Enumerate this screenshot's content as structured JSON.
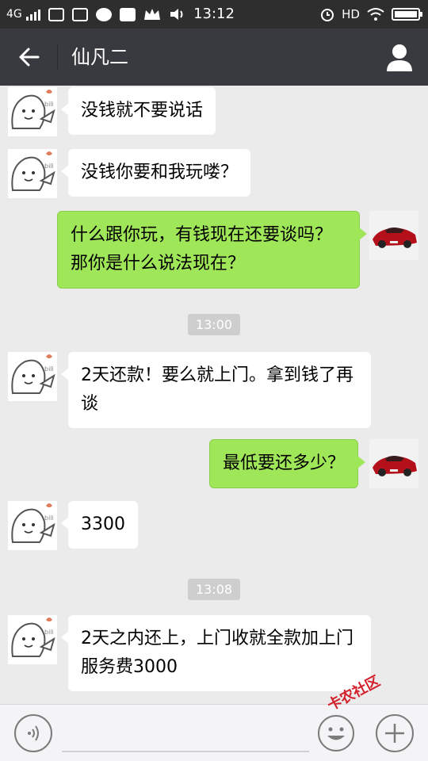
{
  "status_bar": {
    "network": "4G",
    "indicator": "HD",
    "time": "13:12",
    "icons": [
      "signal-icon",
      "gallery-icon",
      "wallet-icon",
      "chat-icon",
      "mail-icon",
      "crown-icon",
      "volume-icon",
      "alarm-icon",
      "wifi-icon",
      "battery-icon"
    ]
  },
  "header": {
    "title": "仙凡二",
    "back_icon": "arrow-left-icon",
    "profile_icon": "person-icon"
  },
  "messages": [
    {
      "type": "in",
      "text": "没钱就不要说话"
    },
    {
      "type": "in",
      "text": "没钱你要和我玩喽？"
    },
    {
      "type": "out",
      "text": "什么跟你玩，有钱现在还要谈吗？那你是什么说法现在？"
    },
    {
      "type": "time",
      "text": "13:00"
    },
    {
      "type": "in",
      "text": "2天还款！要么就上门。拿到钱了再谈"
    },
    {
      "type": "out",
      "text": "最低要还多少？"
    },
    {
      "type": "in",
      "text": "3300"
    },
    {
      "type": "time",
      "text": "13:08"
    },
    {
      "type": "in",
      "text": "2天之内还上，上门收就全款加上门服务费3000"
    }
  ],
  "avatar_tag": "bili",
  "input_bar": {
    "voice_icon": "voice-icon",
    "text_value": "",
    "emoji_icon": "emoji-icon",
    "plus_icon": "plus-icon"
  },
  "watermark": "卡农社区",
  "colors": {
    "status_bg": "#2e2e2e",
    "header_bg": "#393a3f",
    "chat_bg": "#ebebeb",
    "incoming_bubble": "#ffffff",
    "outgoing_bubble": "#9fe658",
    "timestamp_bg": "#cecece",
    "car_red": "#b3101a"
  }
}
